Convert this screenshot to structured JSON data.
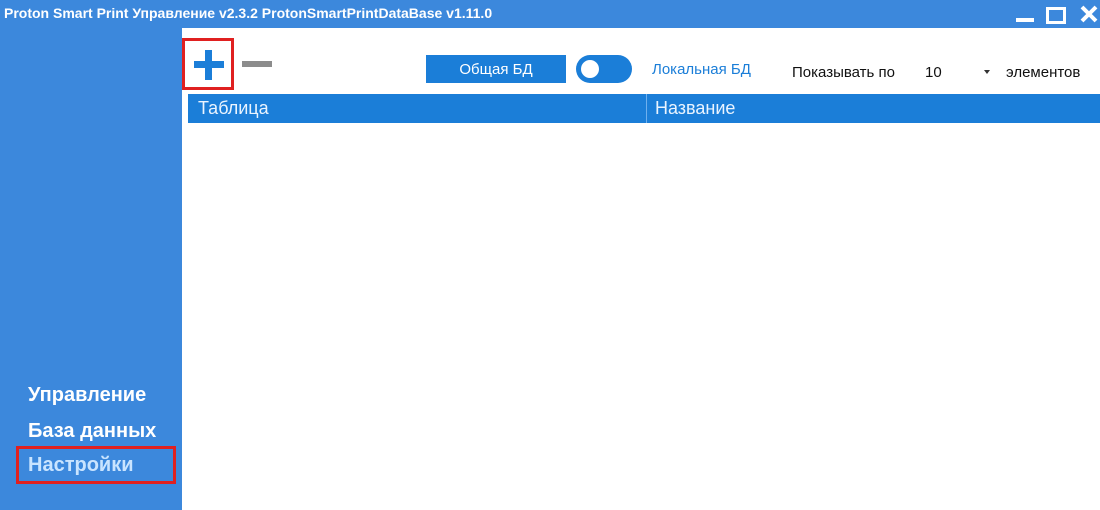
{
  "window": {
    "title": "Proton Smart Print Управление v2.3.2 ProtonSmartPrintDataBase v1.11.0"
  },
  "sidebar": {
    "items": [
      {
        "label": "Управление"
      },
      {
        "label": "База данных"
      },
      {
        "label": "Настройки",
        "active": true
      }
    ]
  },
  "toolbar": {
    "add_icon": "plus-icon",
    "remove_icon": "minus-icon",
    "common_db_label": "Общая БД",
    "local_db_label": "Локальная БД",
    "show_label": "Показывать по",
    "page_size": "10",
    "elements_label": "элементов"
  },
  "table": {
    "columns": [
      "Таблица",
      "Название"
    ],
    "rows": []
  },
  "colors": {
    "accent": "#1b7ed8",
    "sidebar": "#3c88dc",
    "highlight": "#e02020"
  }
}
